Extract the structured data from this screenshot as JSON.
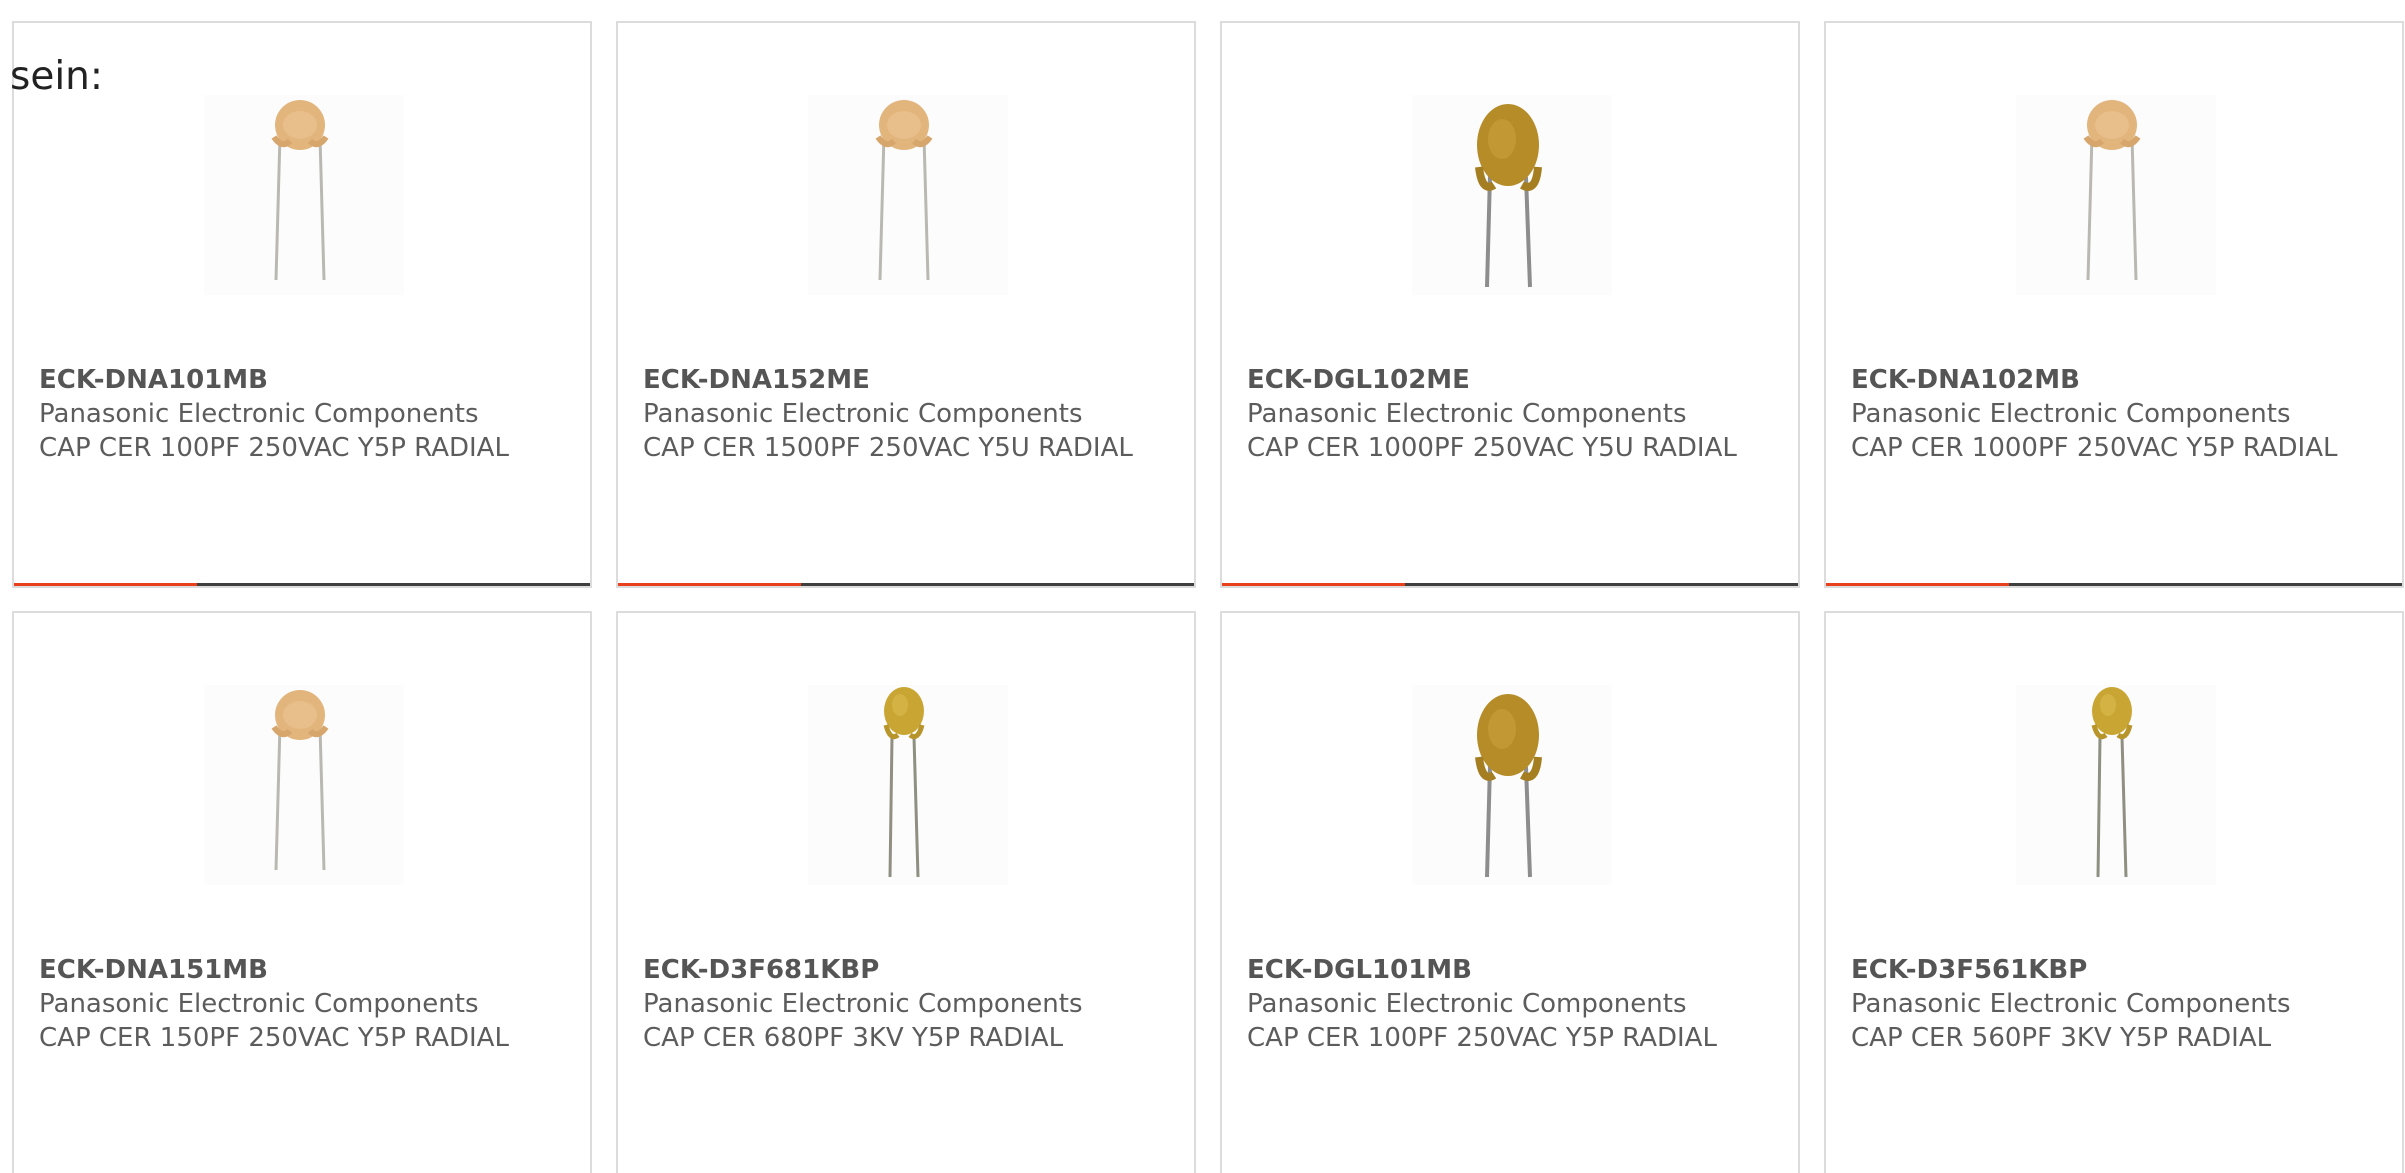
{
  "intro_text": "sein:",
  "colors": {
    "accent": "#e8401c",
    "bar": "#3f3f3f",
    "card_border": "#dcdcdc"
  },
  "products": [
    {
      "part_number": "ECK-DNA101MB",
      "manufacturer": "Panasonic Electronic Components",
      "description": "CAP CER 100PF 250VAC Y5P RADIAL",
      "image_icon": "ceramic-disc-capacitor-light-icon"
    },
    {
      "part_number": "ECK-DNA152ME",
      "manufacturer": "Panasonic Electronic Components",
      "description": "CAP CER 1500PF 250VAC Y5U RADIAL",
      "image_icon": "ceramic-disc-capacitor-light-icon"
    },
    {
      "part_number": "ECK-DGL102ME",
      "manufacturer": "Panasonic Electronic Components",
      "description": "CAP CER 1000PF 250VAC Y5U RADIAL",
      "image_icon": "ceramic-disc-capacitor-large-icon"
    },
    {
      "part_number": "ECK-DNA102MB",
      "manufacturer": "Panasonic Electronic Components",
      "description": "CAP CER 1000PF 250VAC Y5P RADIAL",
      "image_icon": "ceramic-disc-capacitor-light-icon"
    },
    {
      "part_number": "ECK-DNA151MB",
      "manufacturer": "Panasonic Electronic Components",
      "description": "CAP CER 150PF 250VAC Y5P RADIAL",
      "image_icon": "ceramic-disc-capacitor-light-icon"
    },
    {
      "part_number": "ECK-D3F681KBP",
      "manufacturer": "Panasonic Electronic Components",
      "description": "CAP CER 680PF 3KV Y5P RADIAL",
      "image_icon": "ceramic-disc-capacitor-yellow-icon"
    },
    {
      "part_number": "ECK-DGL101MB",
      "manufacturer": "Panasonic Electronic Components",
      "description": "CAP CER 100PF 250VAC Y5P RADIAL",
      "image_icon": "ceramic-disc-capacitor-large-icon"
    },
    {
      "part_number": "ECK-D3F561KBP",
      "manufacturer": "Panasonic Electronic Components",
      "description": "CAP CER 560PF 3KV Y5P RADIAL",
      "image_icon": "ceramic-disc-capacitor-yellow-icon"
    }
  ]
}
